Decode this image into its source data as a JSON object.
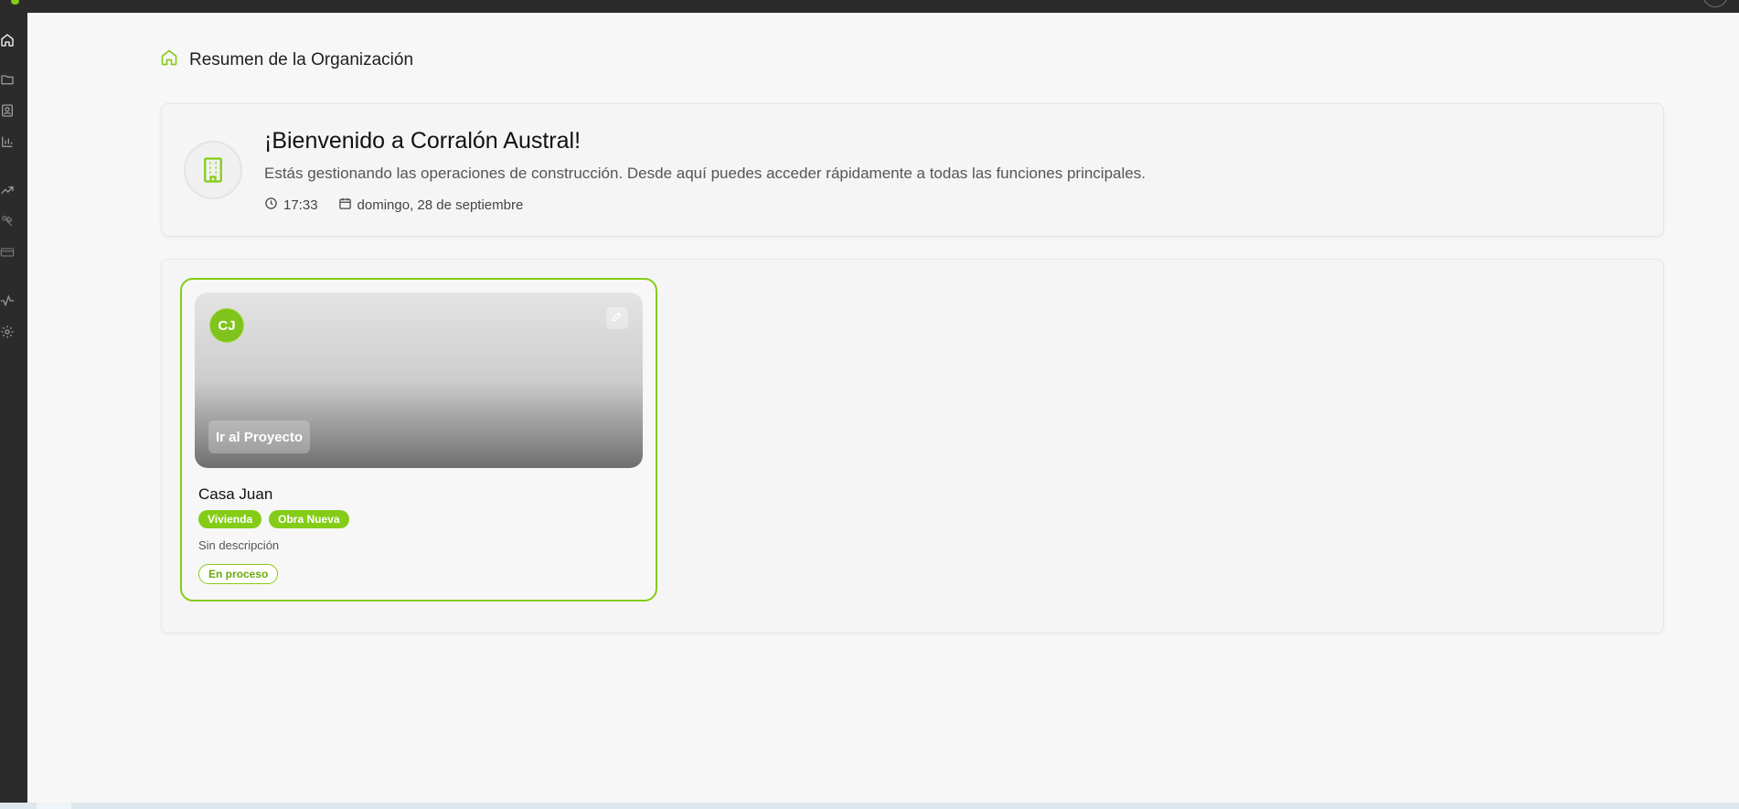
{
  "colors": {
    "accent": "#84cc16",
    "sidebar_bg": "#2b2b2b",
    "page_bg": "#f7f7f7"
  },
  "sidebar": {
    "items": [
      {
        "icon": "home-icon",
        "active": true
      },
      {
        "icon": "folder-icon"
      },
      {
        "icon": "contacts-icon"
      },
      {
        "icon": "bar-chart-icon"
      },
      {
        "icon": "trending-up-icon"
      },
      {
        "icon": "tools-icon"
      },
      {
        "icon": "credit-card-icon"
      },
      {
        "icon": "activity-icon"
      },
      {
        "icon": "settings-icon"
      }
    ]
  },
  "breadcrumb": {
    "icon": "home-icon",
    "label": "Resumen de la Organización"
  },
  "welcome": {
    "icon": "building-icon",
    "title": "¡Bienvenido a Corralón Austral!",
    "description": "Estás gestionando las operaciones de construcción. Desde aquí puedes acceder rápidamente a todas las funciones principales.",
    "time": "17:33",
    "date": "domingo, 28 de septiembre"
  },
  "projects": [
    {
      "initials": "CJ",
      "go_label": "Ir al Proyecto",
      "name": "Casa Juan",
      "tags": [
        "Vivienda",
        "Obra Nueva"
      ],
      "description": "Sin descripción",
      "status": "En proceso"
    }
  ]
}
